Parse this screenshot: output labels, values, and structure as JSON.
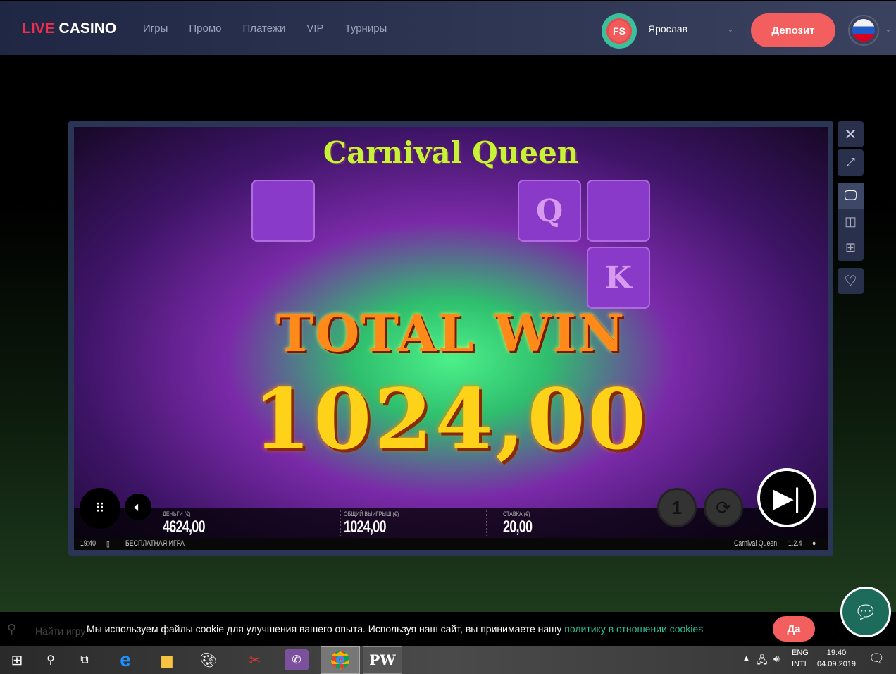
{
  "header": {
    "logo_red": "LIVE",
    "logo_white": "CASINO",
    "nav": [
      "Игры",
      "Промо",
      "Платежи",
      "VIP",
      "Турниры"
    ],
    "avatar_initials": "FS",
    "username": "Ярослав",
    "deposit_label": "Депозит"
  },
  "game": {
    "title": "Carnival Queen",
    "reel_symbols": [
      "Q",
      "K"
    ],
    "total_win_label": "TOTAL WIN",
    "total_win_amount": "1024,00",
    "stats": [
      {
        "label": "ДЕНЬГИ (€)",
        "value": "4624,00"
      },
      {
        "label": "ОБЩИЙ ВЫИГРЫШ (€)",
        "value": "1024,00"
      },
      {
        "label": "СТАВКА (€)",
        "value": "20,00"
      }
    ],
    "footer": {
      "time": "19:40",
      "mode": "БЕСПЛАТНАЯ ИГРА",
      "game_name": "Carnival Queen",
      "version": "1.2.4"
    }
  },
  "cookie": {
    "search_placeholder": "Найти игру",
    "message": "Мы используем файлы cookie для улучшения вашего опыта. Используя наш сайт, вы принимаете нашу ",
    "link": "политику в отношении cookies",
    "accept": "Да"
  },
  "taskbar": {
    "lang1": "ENG",
    "lang2": "INTL",
    "time": "19:40",
    "date": "04.09.2019"
  }
}
